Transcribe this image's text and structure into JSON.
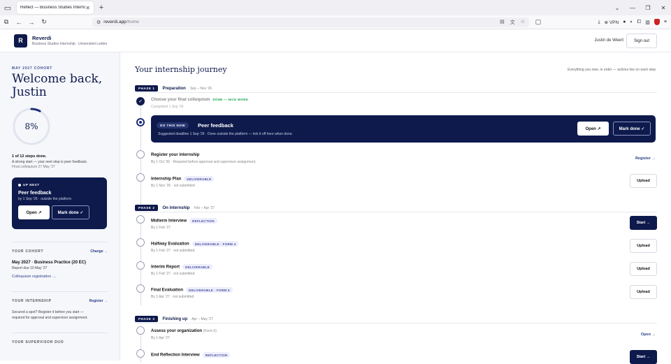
{
  "browser": {
    "tab_title": "Reflect — Business Studies Internshi",
    "url_host": "reverdi.app",
    "url_path": "/home",
    "vpn_label": "VPN"
  },
  "header": {
    "logo_letter": "R",
    "brand": "Reverdi",
    "subtitle": "Business Studies Internship · Universiteit Leiden",
    "user": "Justin de Weert",
    "signout": "Sign out"
  },
  "sidebar": {
    "cohort_label": "MAY 2027 COHORT",
    "welcome_line1": "Welcome back,",
    "welcome_line2": "Justin",
    "progress_percent": 8,
    "progress_text": "8%",
    "steps_done": "1 of 12 steps done.",
    "encouragement": "A strong start — your next step is peer feedback.",
    "final_colloquium": "Final colloquium 27 May '27",
    "upnext": {
      "label": "UP NEXT",
      "title": "Peer feedback",
      "subtitle": "by 1 Sep '26 · outside the platform",
      "open": "Open ↗",
      "mark_done": "Mark done ✓"
    },
    "cohort": {
      "heading": "YOUR COHORT",
      "action": "Change →",
      "title": "May 2027 · Business Practice (20 EC)",
      "report_due": "Report due 10 May '27",
      "link": "Colloquium registration →"
    },
    "internship": {
      "heading": "YOUR INTERNSHIP",
      "action": "Register →",
      "text1": "Secured a spot? Register it before you start —",
      "text2": "required for approval and supervisor assignment."
    },
    "supervisor": {
      "heading": "YOUR SUPERVISOR DUO"
    }
  },
  "main": {
    "title": "Your internship journey",
    "hint": "Everything you owe, in order — actions live on each step",
    "phases": [
      {
        "badge": "PHASE 1",
        "name": "Preparation",
        "dates": "Sep – Nov '26"
      },
      {
        "badge": "PHASE 2",
        "name": "On internship",
        "dates": "Feb – Apr '27"
      },
      {
        "badge": "PHASE 3",
        "name": "Finishing up",
        "dates": "Apr – May '27"
      }
    ],
    "steps": {
      "colloquium": {
        "title": "Choose your final colloquium",
        "done": "DONE — NICE WORK",
        "sub": "Completed 1 Sep '26"
      },
      "peer": {
        "badge": "DO THIS NOW",
        "title": "Peer feedback",
        "sub": "Suggested deadline 1 Sep '26 · Done outside the platform — tick it off here when done.",
        "open": "Open ↗",
        "mark_done": "Mark done ✓"
      },
      "register": {
        "title": "Register your internship",
        "sub": "By 1 Oct '26 · Required before approval and supervisor assignment.",
        "action": "Register →"
      },
      "plan": {
        "title": "Internship Plan",
        "tag": "DELIVERABLE",
        "sub": "By 1 Nov '26 · not submitted",
        "action": "Upload"
      },
      "midterm": {
        "title": "Midterm Interview",
        "tag": "REFLECTION",
        "sub": "By 1 Feb '27",
        "action": "Start →"
      },
      "halfway": {
        "title": "Halfway Evaluation",
        "tag": "DELIVERABLE · FORM 4",
        "sub": "By 1 Feb '27 · not submitted",
        "action": "Upload"
      },
      "interim": {
        "title": "Interim Report",
        "tag": "DELIVERABLE",
        "sub": "By 1 Feb '27 · not submitted",
        "action": "Upload"
      },
      "final": {
        "title": "Final Evaluation",
        "tag": "DELIVERABLE · FORM 5",
        "sub": "By 1 Apr '27 · not submitted",
        "action": "Upload"
      },
      "assess": {
        "title": "Assess your organization",
        "form": "(Form 6)",
        "sub": "By 1 Apr '27",
        "action": "Open →"
      },
      "endref": {
        "title": "End Reflection Interview",
        "tag": "REFLECTION",
        "action": "Start →"
      }
    }
  }
}
